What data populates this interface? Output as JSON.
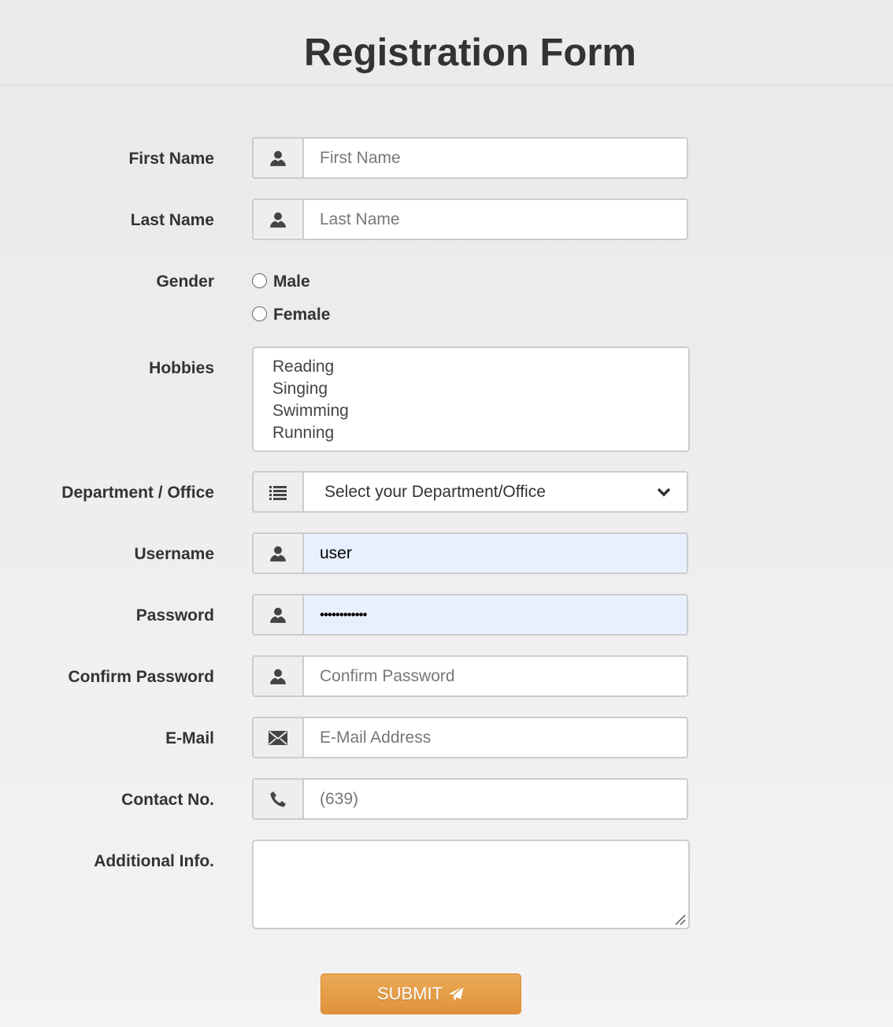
{
  "title": "Registration Form",
  "fields": {
    "first_name": {
      "label": "First Name",
      "placeholder": "First Name",
      "icon": "user-icon"
    },
    "last_name": {
      "label": "Last Name",
      "placeholder": "Last Name",
      "icon": "user-icon"
    },
    "gender": {
      "label": "Gender",
      "options": [
        "Male",
        "Female"
      ]
    },
    "hobbies": {
      "label": "Hobbies",
      "options": [
        "Reading",
        "Singing",
        "Swimming",
        "Running"
      ]
    },
    "department": {
      "label": "Department / Office",
      "selected": "Select your Department/Office",
      "icon": "list-icon"
    },
    "username": {
      "label": "Username",
      "value": "user",
      "icon": "user-icon"
    },
    "password": {
      "label": "Password",
      "value_masked": "••••••••••••",
      "icon": "user-icon"
    },
    "confirm_password": {
      "label": "Confirm Password",
      "placeholder": "Confirm Password",
      "icon": "user-icon"
    },
    "email": {
      "label": "E-Mail",
      "placeholder": "E-Mail Address",
      "icon": "envelope-icon"
    },
    "contact": {
      "label": "Contact No.",
      "placeholder": "(639)",
      "icon": "phone-icon"
    },
    "additional_info": {
      "label": "Additional Info."
    }
  },
  "submit_label": "SUBMIT",
  "colors": {
    "accent": "#e69a42",
    "autofill": "#e8f0fe"
  }
}
